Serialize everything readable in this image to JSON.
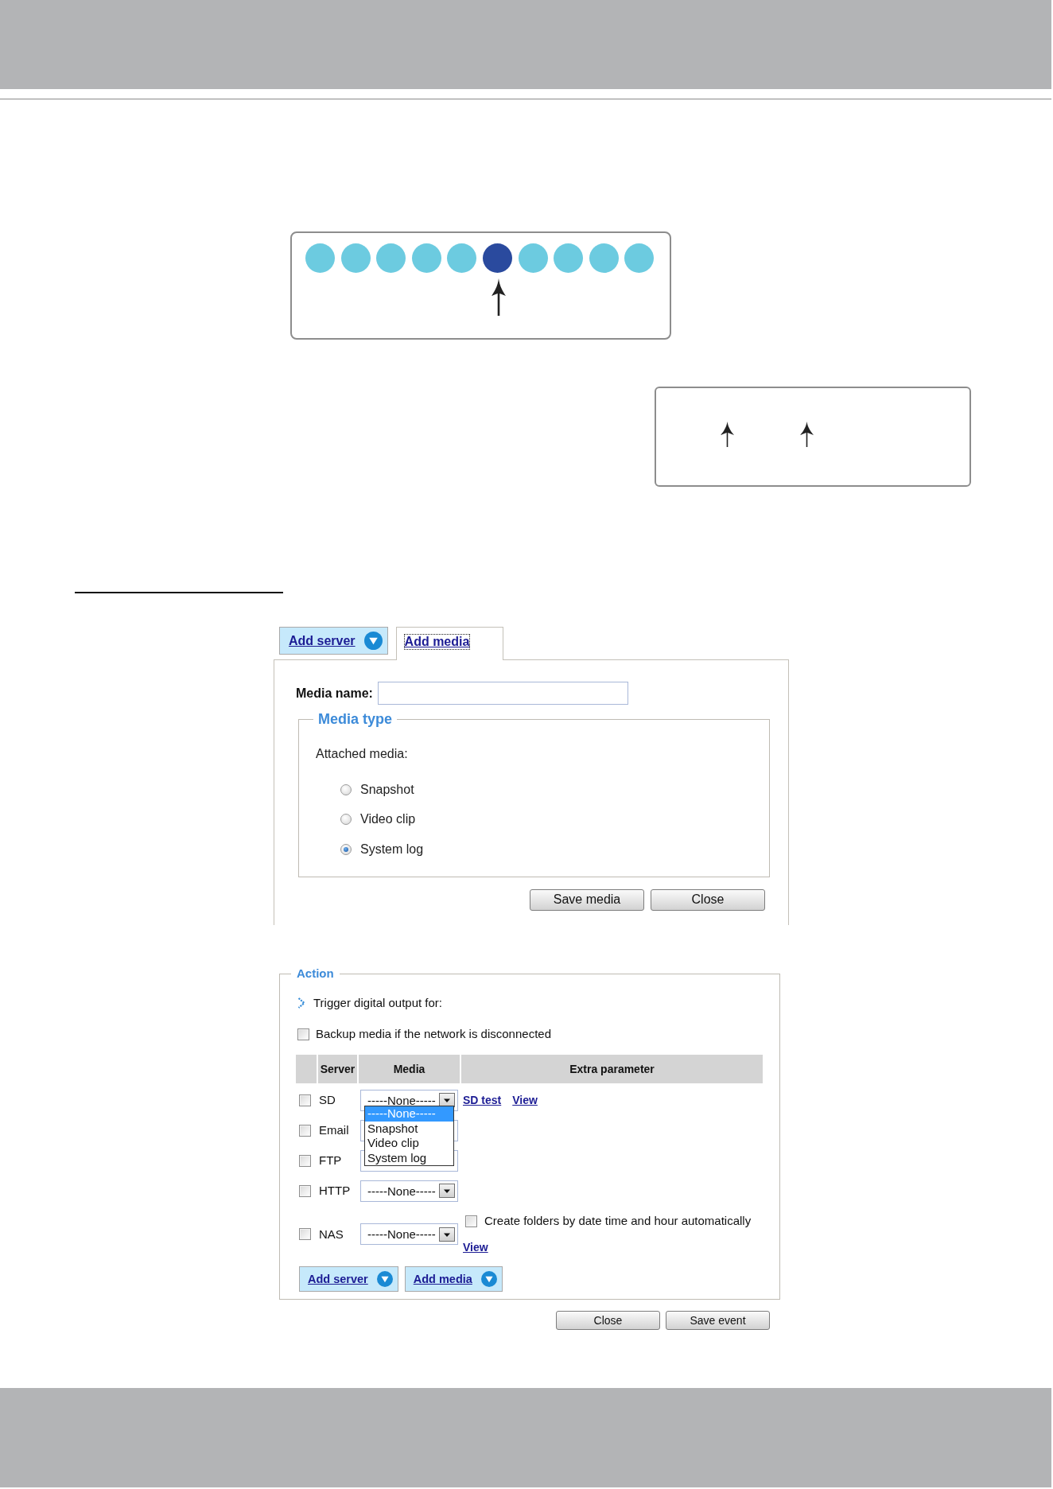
{
  "dot_diagram": {
    "dots": [
      {
        "color": "#6ccbe0"
      },
      {
        "color": "#6ccbe0"
      },
      {
        "color": "#6ccbe0"
      },
      {
        "color": "#6ccbe0"
      },
      {
        "color": "#6ccbe0"
      },
      {
        "color": "#2a4a9e"
      },
      {
        "color": "#6ccbe0"
      },
      {
        "color": "#6ccbe0"
      },
      {
        "color": "#6ccbe0"
      },
      {
        "color": "#6ccbe0"
      }
    ]
  },
  "media_dialog": {
    "tabs": [
      {
        "label": "Add server",
        "expanded": false
      },
      {
        "label": "Add media",
        "expanded": true
      }
    ],
    "media_name": {
      "label": "Media name:"
    },
    "media_type": {
      "legend": "Media type",
      "prompt": "Attached media:",
      "options": [
        {
          "label": "Snapshot",
          "selected": false
        },
        {
          "label": "Video clip",
          "selected": false
        },
        {
          "label": "System log",
          "selected": true
        }
      ]
    },
    "buttons": [
      "Save media",
      "Close"
    ]
  },
  "action": {
    "legend": "Action",
    "trigger": "Trigger digital output for:",
    "backup": {
      "label": "Backup media if the network is disconnected",
      "checked": false
    },
    "table": {
      "columns": [
        "Server",
        "Media",
        "Extra parameter"
      ],
      "rows": [
        {
          "server": "SD",
          "checked": false,
          "media": {
            "value": "-----None-----",
            "expanded": true,
            "options": [
              {
                "label": "-----None-----",
                "selected": true
              },
              {
                "label": "Snapshot",
                "selected": false
              },
              {
                "label": "Video clip",
                "selected": false
              },
              {
                "label": "System log",
                "selected": false
              }
            ]
          },
          "extras": [
            {
              "kind": "link",
              "label": "SD test"
            },
            {
              "kind": "link",
              "label": "View"
            }
          ]
        },
        {
          "server": "Email",
          "checked": false,
          "media": {
            "expanded": false
          }
        },
        {
          "server": "FTP",
          "checked": false,
          "media": {
            "expanded": false
          }
        },
        {
          "server": "HTTP",
          "checked": false,
          "media": {
            "value": "-----None-----",
            "expanded": false
          }
        },
        {
          "server": "NAS",
          "checked": false,
          "media": {
            "value": "-----None-----",
            "expanded": false
          },
          "extras": [
            {
              "kind": "checkbox",
              "label": "Create folders by date time and hour automatically",
              "checked": false
            },
            {
              "kind": "link",
              "label": "View"
            }
          ]
        }
      ]
    },
    "add_buttons": [
      {
        "label": "Add server",
        "expanded": false
      },
      {
        "label": "Add media",
        "expanded": false
      }
    ],
    "buttons": [
      "Close",
      "Save event"
    ]
  }
}
